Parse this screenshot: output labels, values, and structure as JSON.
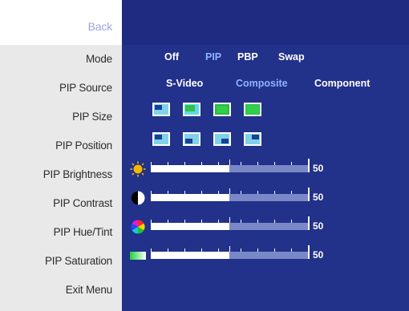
{
  "menu": {
    "back": "Back",
    "items": [
      "Mode",
      "PIP Source",
      "PIP Size",
      "PIP Position",
      "PIP Brightness",
      "PIP Contrast",
      "PIP Hue/Tint",
      "PIP Saturation",
      "Exit Menu"
    ]
  },
  "mode": {
    "options": [
      "Off",
      "PIP",
      "PBP",
      "Swap"
    ],
    "selected": "PIP"
  },
  "source": {
    "options": [
      "S-Video",
      "Composite",
      "Component"
    ],
    "selected": "Composite"
  },
  "sliders": [
    {
      "name": "brightness",
      "value": "50",
      "icon": "sun-icon",
      "fraction": 0.5
    },
    {
      "name": "contrast",
      "value": "50",
      "icon": "contrast-icon",
      "fraction": 0.5
    },
    {
      "name": "hue",
      "value": "50",
      "icon": "color-wheel-icon",
      "fraction": 0.5
    },
    {
      "name": "saturation",
      "value": "50",
      "icon": "saturation-icon",
      "fraction": 0.5
    }
  ],
  "colors": {
    "panel": "#22318a",
    "selected_text": "#8fb4ff",
    "back_text": "#9aa6e2"
  }
}
